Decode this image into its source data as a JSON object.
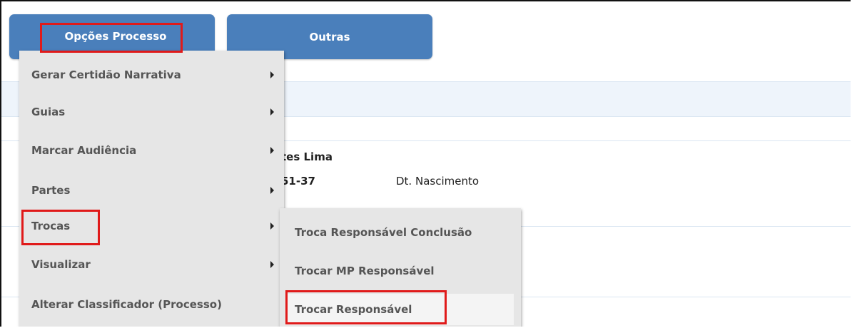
{
  "tabs": [
    {
      "label": "Opções Processo"
    },
    {
      "label": "Outras"
    }
  ],
  "background": {
    "name_fragment": "tes Lima",
    "id_fragment": "51-37",
    "dt_label": "Dt. Nascimento"
  },
  "menu": {
    "items": [
      {
        "label": "Gerar Certidão Narrativa",
        "has_submenu": true
      },
      {
        "label": "Guias",
        "has_submenu": true
      },
      {
        "label": "Marcar Audiência",
        "has_submenu": true
      },
      {
        "label": "Partes",
        "has_submenu": true
      },
      {
        "label": "Trocas",
        "has_submenu": true
      },
      {
        "label": "Visualizar",
        "has_submenu": true
      },
      {
        "label": "Alterar Classificador (Processo)",
        "has_submenu": false
      }
    ]
  },
  "submenu": {
    "items": [
      {
        "label": "Troca Responsável Conclusão"
      },
      {
        "label": "Trocar MP Responsável"
      },
      {
        "label": "Trocar Responsável"
      }
    ]
  },
  "colors": {
    "tab_bg": "#4a7fbb",
    "menu_bg": "#e6e6e6",
    "highlight": "#e01a1a"
  }
}
